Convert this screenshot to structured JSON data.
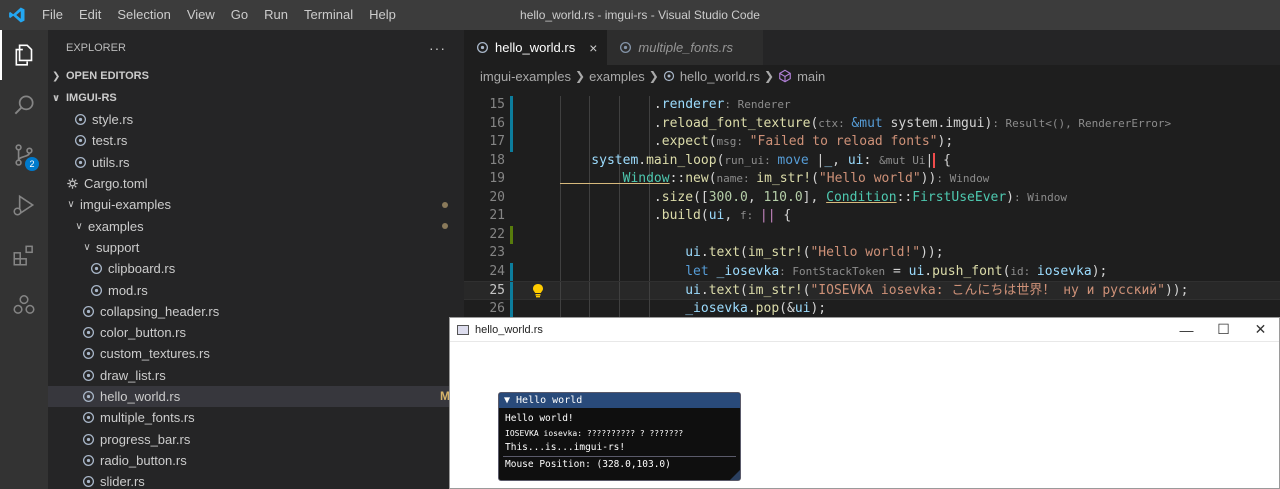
{
  "menubar": [
    "File",
    "Edit",
    "Selection",
    "View",
    "Go",
    "Run",
    "Terminal",
    "Help"
  ],
  "window_title": "hello_world.rs - imgui-rs - Visual Studio Code",
  "activity_bar": {
    "items": [
      "explorer-icon",
      "search-icon",
      "source-control-icon",
      "run-debug-icon",
      "extensions-icon",
      "remote-icon"
    ],
    "scm_badge": "2"
  },
  "sidebar": {
    "title": "EXPLORER",
    "more": "···",
    "open_editors": "OPEN EDITORS",
    "workspace": "IMGUI-RS",
    "tree": [
      {
        "label": "style.rs",
        "indent": 2,
        "type": "rs"
      },
      {
        "label": "test.rs",
        "indent": 2,
        "type": "rs"
      },
      {
        "label": "utils.rs",
        "indent": 2,
        "type": "rs"
      },
      {
        "label": "Cargo.toml",
        "indent": 1,
        "type": "gear"
      },
      {
        "label": "imgui-examples",
        "indent": 1,
        "type": "folder",
        "dot": true
      },
      {
        "label": "examples",
        "indent": 2,
        "type": "folder",
        "dot": true
      },
      {
        "label": "support",
        "indent": 3,
        "type": "folder"
      },
      {
        "label": "clipboard.rs",
        "indent": 4,
        "type": "rs"
      },
      {
        "label": "mod.rs",
        "indent": 4,
        "type": "rs"
      },
      {
        "label": "collapsing_header.rs",
        "indent": 3,
        "type": "rs"
      },
      {
        "label": "color_button.rs",
        "indent": 3,
        "type": "rs"
      },
      {
        "label": "custom_textures.rs",
        "indent": 3,
        "type": "rs"
      },
      {
        "label": "draw_list.rs",
        "indent": 3,
        "type": "rs"
      },
      {
        "label": "hello_world.rs",
        "indent": 3,
        "type": "rs",
        "selected": true,
        "mod": "M"
      },
      {
        "label": "multiple_fonts.rs",
        "indent": 3,
        "type": "rs"
      },
      {
        "label": "progress_bar.rs",
        "indent": 3,
        "type": "rs"
      },
      {
        "label": "radio_button.rs",
        "indent": 3,
        "type": "rs"
      },
      {
        "label": "slider.rs",
        "indent": 3,
        "type": "rs"
      }
    ]
  },
  "tabs": [
    {
      "label": "hello_world.rs",
      "active": true,
      "close": "×"
    },
    {
      "label": "multiple_fonts.rs",
      "active": false
    }
  ],
  "breadcrumb": [
    "imgui-examples",
    "examples",
    "hello_world.rs",
    "main"
  ],
  "code": {
    "current_line": 25,
    "lines": [
      {
        "n": "15",
        "gutter": "#0c7d9d",
        "html": "<span class=\"p\">            .</span><span class=\"v\">renderer</span><span class=\"hint\">: Renderer</span>"
      },
      {
        "n": "16",
        "gutter": "#0c7d9d",
        "html": "<span class=\"p\">            .</span><span class=\"f\">reload_font_texture</span><span class=\"p\">(</span><span class=\"hint\">ctx: </span><span class=\"k\">&amp;mut</span><span class=\"p\"> system.imgui)</span><span class=\"hint\">: Result&lt;(), RendererError&gt;</span>"
      },
      {
        "n": "17",
        "gutter": "#0c7d9d",
        "html": "<span class=\"p\">            .</span><span class=\"f\">expect</span><span class=\"p\">(</span><span class=\"hint\">msg: </span><span class=\"s\">\"Failed to reload fonts\"</span><span class=\"p\">);</span>"
      },
      {
        "n": "18",
        "gutter": "",
        "html": "<span class=\"v\">    system</span><span class=\"p\">.</span><span class=\"f\">main_loop</span><span class=\"p\">(</span><span class=\"hint\">run_ui: </span><span class=\"k\">move</span><span class=\"p\"> |</span><span class=\"v\">_</span><span class=\"p\">, </span><span class=\"v\">ui</span><span class=\"p\">: </span><span class=\"hint\">&amp;mut Ui</span><span class=\"p err\">|</span><span class=\"p\"> {</span>"
      },
      {
        "n": "19",
        "gutter": "",
        "html": "<span class=\"t warn\">        Window</span><span class=\"p\">::</span><span class=\"f\">new</span><span class=\"p\">(</span><span class=\"hint\">name: </span><span class=\"f\">im_str!</span><span class=\"p\">(</span><span class=\"s\">\"Hello world\"</span><span class=\"p\">))</span><span class=\"hint\">: Window</span>"
      },
      {
        "n": "20",
        "gutter": "",
        "html": "<span class=\"p\">            .</span><span class=\"f\">size</span><span class=\"p\">([</span><span class=\"n\">300.0</span><span class=\"p\">, </span><span class=\"n\">110.0</span><span class=\"p\">], </span><span class=\"t warn\">Condition</span><span class=\"p\">::</span><span class=\"t\">FirstUseEver</span><span class=\"p\">)</span><span class=\"hint\">: Window</span>"
      },
      {
        "n": "21",
        "gutter": "",
        "html": "<span class=\"p\">            .</span><span class=\"f\">build</span><span class=\"p\">(</span><span class=\"v\">ui</span><span class=\"p\">, </span><span class=\"hint\">f: </span><span class=\"k2\">||</span><span class=\"p\"> {</span>"
      },
      {
        "n": "22",
        "gutter": "#587c0c",
        "html": ""
      },
      {
        "n": "23",
        "gutter": "",
        "html": "<span class=\"v\">                ui</span><span class=\"p\">.</span><span class=\"f\">text</span><span class=\"p\">(</span><span class=\"f\">im_str!</span><span class=\"p\">(</span><span class=\"s\">\"Hello world!\"</span><span class=\"p\">));</span>"
      },
      {
        "n": "24",
        "gutter": "#0c7d9d",
        "html": "<span class=\"k\">                let</span><span class=\"v\"> _iosevka</span><span class=\"hint\">: FontStackToken</span><span class=\"p\"> = </span><span class=\"v\">ui</span><span class=\"p\">.</span><span class=\"f\">push_font</span><span class=\"p\">(</span><span class=\"hint\">id: </span><span class=\"v\">iosevka</span><span class=\"p\">);</span>"
      },
      {
        "n": "25",
        "gutter": "#0c7d9d",
        "html": "<span class=\"v\">                ui</span><span class=\"p\">.</span><span class=\"f\">text</span><span class=\"p\">(</span><span class=\"f\">im_str!</span><span class=\"p\">(</span><span class=\"s\">\"IOSEVKA iosevka: こんにちは世界！ ну и русский\"</span><span class=\"p\">));</span>"
      },
      {
        "n": "26",
        "gutter": "#0c7d9d",
        "html": "<span class=\"v\">                _iosevka</span><span class=\"p\">.</span><span class=\"f\">pop</span><span class=\"p\">(&amp;</span><span class=\"v\">ui</span><span class=\"p\">);</span>"
      }
    ]
  },
  "hello_window": {
    "title": "hello_world.rs",
    "minimize": "—",
    "maximize": "☐",
    "close": "✕"
  },
  "imgui": {
    "title": "▼ Hello world",
    "line1": "Hello world!",
    "line2": "IOSEVKA iosevka: ?????????? ? ???????",
    "line3": "This...is...imgui-rs!",
    "line4": "Mouse Position: (328.0,103.0)"
  },
  "colors": {
    "accent": "#007acc",
    "sidebar_bg": "#252526",
    "editor_bg": "#1e1e1e",
    "imgui_title": "#294a7a"
  }
}
